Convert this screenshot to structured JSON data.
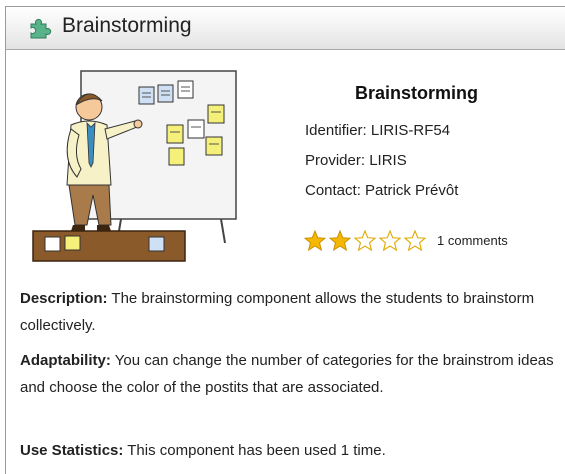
{
  "panel": {
    "title": "Brainstorming",
    "title_icon": "puzzle-piece-icon"
  },
  "component": {
    "name": "Brainstorming",
    "image": "teacher-at-whiteboard-illustration",
    "identifier": "Identifier: LIRIS-RF54",
    "provider": "Provider: LIRIS",
    "contact": "Contact: Patrick Prévôt",
    "rating": {
      "value": 2,
      "max": 5,
      "filled_color": "#f5b800"
    },
    "comments": "1 comments"
  },
  "description": {
    "label": "Description:",
    "text": " The brainstorming component allows the students to brainstorm collectively."
  },
  "adaptability": {
    "label": "Adaptability:",
    "text": " You can change the number of categories for the brainstrom ideas and choose the color of the postits that are associated."
  },
  "use_statistics": {
    "label": "Use Statistics:",
    "text": " This component has been used 1 time."
  }
}
